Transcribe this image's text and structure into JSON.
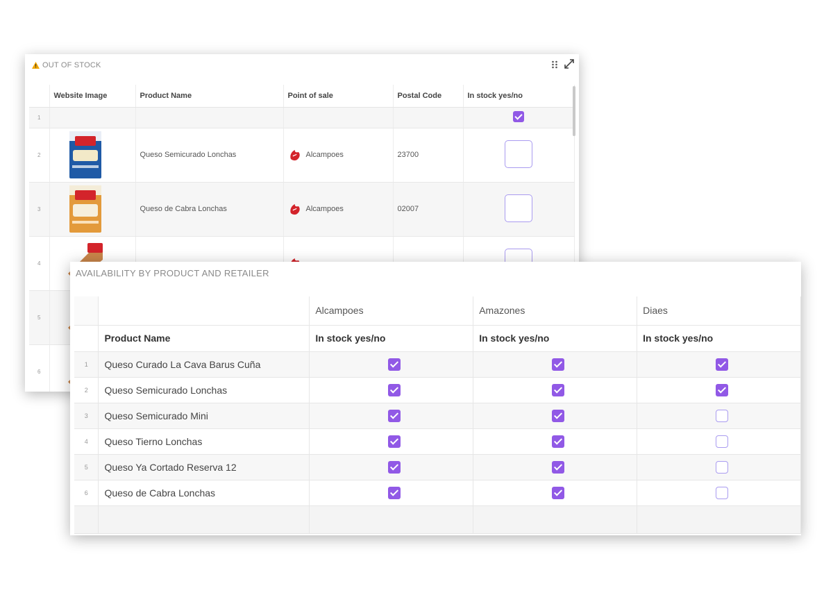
{
  "out_of_stock": {
    "title": "OUT OF STOCK",
    "columns": [
      "Website Image",
      "Product Name",
      "Point of sale",
      "Postal Code",
      "In stock yes/no"
    ],
    "rows": [
      {
        "num": "1",
        "product": "",
        "pos": "",
        "postal": "",
        "in_stock": "checked"
      },
      {
        "num": "2",
        "product": "Queso Semicurado Lonchas",
        "pos": "Alcampoes",
        "postal": "23700",
        "in_stock": "empty"
      },
      {
        "num": "3",
        "product": "Queso de Cabra Lonchas",
        "pos": "Alcampoes",
        "postal": "02007",
        "in_stock": "empty"
      },
      {
        "num": "4",
        "product": "",
        "pos": "",
        "postal": "",
        "in_stock": "empty"
      },
      {
        "num": "5",
        "product": "",
        "pos": "",
        "postal": "",
        "in_stock": ""
      },
      {
        "num": "6",
        "product": "",
        "pos": "",
        "postal": "",
        "in_stock": ""
      }
    ]
  },
  "availability": {
    "title": "AVAILABILITY BY PRODUCT AND RETAILER",
    "retailers": [
      "Alcampoes",
      "Amazones",
      "Diaes"
    ],
    "product_header": "Product Name",
    "stock_header": "In stock yes/no",
    "rows": [
      {
        "num": "1",
        "product": "Queso Curado La Cava Barus Cuña",
        "stock": [
          true,
          true,
          true
        ]
      },
      {
        "num": "2",
        "product": "Queso Semicurado Lonchas",
        "stock": [
          true,
          true,
          true
        ]
      },
      {
        "num": "3",
        "product": "Queso Semicurado Mini",
        "stock": [
          true,
          true,
          false
        ]
      },
      {
        "num": "4",
        "product": "Queso Tierno Lonchas",
        "stock": [
          true,
          true,
          false
        ]
      },
      {
        "num": "5",
        "product": "Queso Ya Cortado Reserva 12",
        "stock": [
          true,
          true,
          false
        ]
      },
      {
        "num": "6",
        "product": "Queso de Cabra Lonchas",
        "stock": [
          true,
          true,
          false
        ]
      }
    ]
  },
  "colors": {
    "checkbox_checked": "#9159e6",
    "checkbox_border": "#a99bf0",
    "warning": "#f0a500",
    "retailer_logo": "#d3242b"
  },
  "icons": {
    "warning": "warning-icon",
    "drag": "drag-handle-icon",
    "expand": "expand-icon",
    "retailer": "alcampoes-logo-icon"
  }
}
